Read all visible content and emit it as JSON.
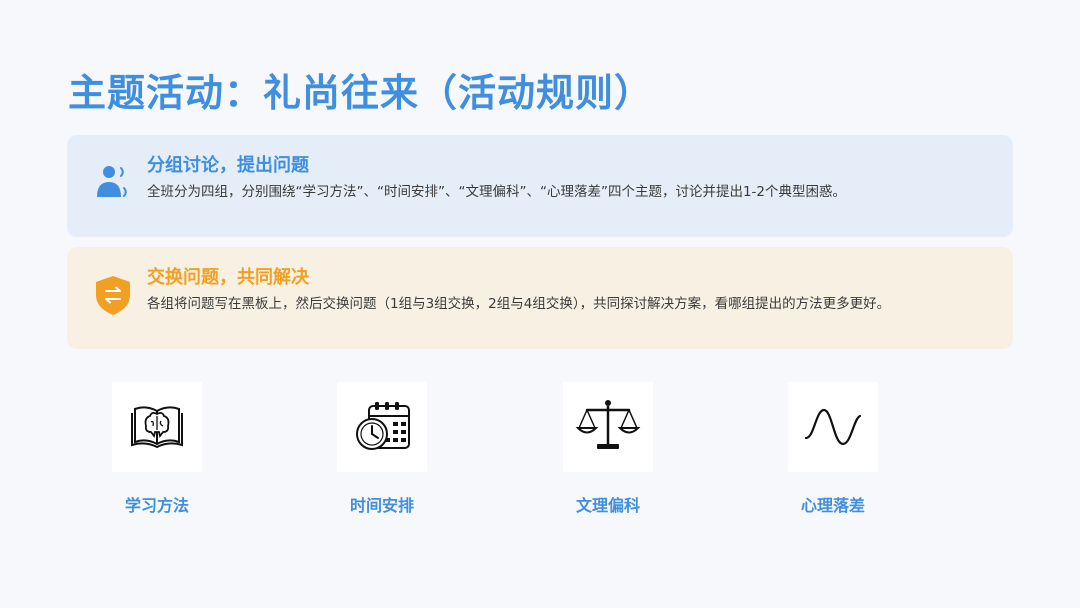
{
  "title": "主题活动：礼尚往来（活动规则）",
  "cards": [
    {
      "title": "分组讨论，提出问题",
      "body": "全班分为四组，分别围绕“学习方法”、“时间安排”、“文理偏科”、“心理落差”四个主题，讨论并提出1-2个典型困惑。",
      "icon": "person-speaking-icon",
      "color": "#3f8ee0"
    },
    {
      "title": "交换问题，共同解决",
      "body": "各组将问题写在黑板上，然后交换问题（1组与3组交换，2组与4组交换），共同探讨解决方案，看哪组提出的方法更多更好。",
      "icon": "shield-exchange-icon",
      "color": "#f2a024"
    }
  ],
  "topics": [
    {
      "label": "学习方法",
      "icon": "book-brain-icon"
    },
    {
      "label": "时间安排",
      "icon": "clock-calendar-icon"
    },
    {
      "label": "文理偏科",
      "icon": "balance-scale-icon"
    },
    {
      "label": "心理落差",
      "icon": "sine-wave-icon"
    }
  ]
}
